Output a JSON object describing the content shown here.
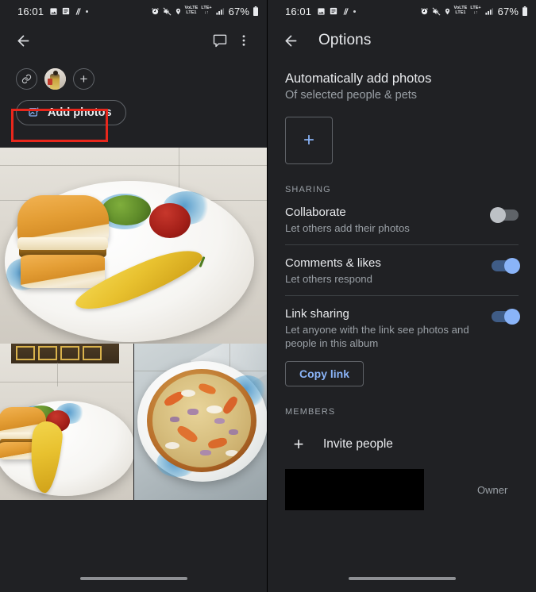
{
  "status_bar": {
    "time": "16:01",
    "left_icons": [
      "image-icon",
      "article-icon",
      "slash-icon",
      "dot-icon"
    ],
    "right_icons": [
      "alarm-icon",
      "mute-icon",
      "location-icon"
    ],
    "network": {
      "line1": "VoLTE",
      "line2": "LTE1",
      "carrier": "LTE+",
      "arrows": "↓↑"
    },
    "signal": "signal-bars-icon",
    "battery_pct": "67%",
    "battery_icon": "battery-icon"
  },
  "left_panel": {
    "app_bar": {
      "back": "back-arrow-icon",
      "comment": "comment-icon",
      "overflow": "more-vert-icon"
    },
    "avatars": {
      "link_chip": "link-icon",
      "member_photo": "member-avatar",
      "add_member": "+"
    },
    "add_photos_button": {
      "label": "Add photos",
      "icon": "add-photo-icon"
    },
    "photos": [
      {
        "name": "vada-pav-plate-large",
        "alt": "Vada pav with green chutney, ketchup and fried chilli on a floral plate"
      },
      {
        "name": "vada-pav-plate-small",
        "alt": "Vada pav with chutney and chilli on a plate"
      },
      {
        "name": "pizza-plate-small",
        "alt": "Homemade pizza with onion and capsicum on a floral plate"
      }
    ]
  },
  "right_panel": {
    "app_bar": {
      "back": "back-arrow-icon",
      "title": "Options"
    },
    "auto_add": {
      "title": "Automatically add photos",
      "subtitle": "Of selected people & pets",
      "add_button": "+"
    },
    "sharing_label": "SHARING",
    "settings": [
      {
        "title": "Collaborate",
        "subtitle": "Let others add their photos",
        "toggle": "off"
      },
      {
        "title": "Comments & likes",
        "subtitle": "Let others respond",
        "toggle": "on"
      },
      {
        "title": "Link sharing",
        "subtitle": "Let anyone with the link see photos and people in this album",
        "toggle": "on"
      }
    ],
    "copy_link_label": "Copy link",
    "members_label": "MEMBERS",
    "invite": {
      "icon": "+",
      "label": "Invite people"
    },
    "member_row": {
      "name_redacted": "",
      "role": "Owner"
    }
  },
  "annotations": {
    "highlight_color": "#e8271c",
    "boxes": [
      "add-photos-button",
      "sharing-settings-group"
    ]
  },
  "colors": {
    "background": "#202124",
    "accent_blue": "#8ab4f8",
    "text_primary": "#e8eaed",
    "text_secondary": "#9aa0a6",
    "divider": "#3c4043"
  }
}
